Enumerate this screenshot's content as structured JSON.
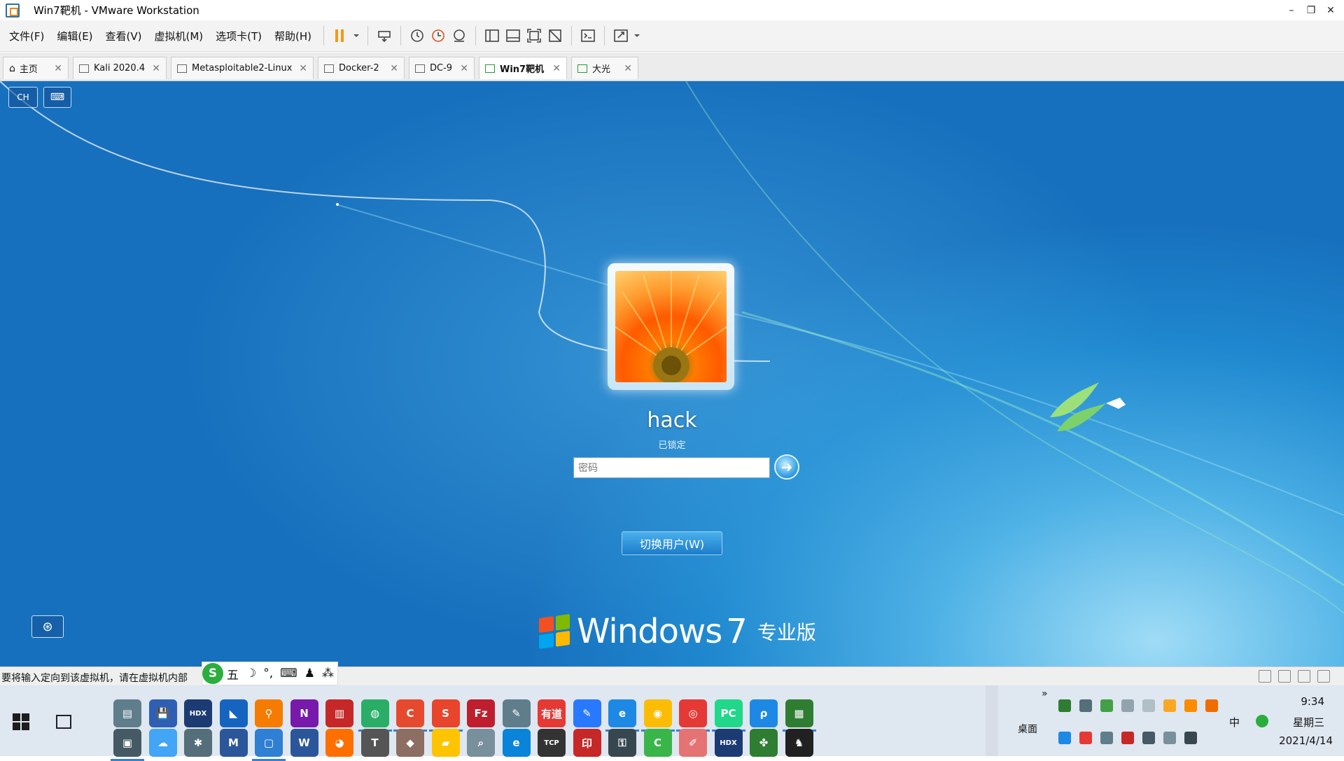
{
  "window": {
    "title": "Win7靶机 - VMware Workstation",
    "minimize": "–",
    "restore": "❐",
    "close": "✕"
  },
  "menu": [
    "文件(F)",
    "编辑(E)",
    "查看(V)",
    "虚拟机(M)",
    "选项卡(T)",
    "帮助(H)"
  ],
  "tabs": [
    {
      "label": "主页"
    },
    {
      "label": "Kali 2020.4"
    },
    {
      "label": "Metasploitable2-Linux"
    },
    {
      "label": "Docker-2"
    },
    {
      "label": "DC-9"
    },
    {
      "label": "Win7靶机"
    },
    {
      "label": "大光"
    }
  ],
  "vm": {
    "ch_label": "CH",
    "kb_label": "⌨",
    "user_name": "hack",
    "user_status": "已锁定",
    "password_placeholder": "密码",
    "go_arrow": "➜",
    "switch_user": "切换用户(W)",
    "ease_icon": "⊛",
    "brand_word": "Windows",
    "brand_version": "7",
    "brand_edition": "专业版",
    "flag_colors": [
      "#f25022",
      "#7fba00",
      "#00a4ef",
      "#ffb900"
    ]
  },
  "statusbar": {
    "message": "要将输入定向到该虚拟机，请在虚拟机内部",
    "ime": [
      "五",
      "☽",
      "°,",
      "⌨",
      "♟",
      "⁂"
    ]
  },
  "taskbar": {
    "apps": [
      {
        "name": "app-1",
        "color": "#607d8b",
        "glyph": "▤"
      },
      {
        "name": "app-2",
        "color": "#2f5fb3",
        "glyph": "💾"
      },
      {
        "name": "hdx-app",
        "color": "#1d3b73",
        "glyph": "HDX"
      },
      {
        "name": "wireshark-app",
        "color": "#1565c0",
        "glyph": "◣"
      },
      {
        "name": "search-app",
        "color": "#f57c00",
        "glyph": "⚲"
      },
      {
        "name": "onenote-app",
        "color": "#7719aa",
        "glyph": "N"
      },
      {
        "name": "library-app",
        "color": "#c62828",
        "glyph": "▥"
      },
      {
        "name": "wechat-app",
        "color": "#2aae67",
        "glyph": "◍"
      },
      {
        "name": "c-app",
        "color": "#e64a2e",
        "glyph": "C"
      },
      {
        "name": "s-app",
        "color": "#e8452c",
        "glyph": "S"
      },
      {
        "name": "filezilla-app",
        "color": "#bf1e2e",
        "glyph": "Fz"
      },
      {
        "name": "editor-app",
        "color": "#607d8b",
        "glyph": "✎"
      },
      {
        "name": "youdao-app",
        "color": "#e53935",
        "glyph": "有道"
      },
      {
        "name": "note-app",
        "color": "#2979ff",
        "glyph": "✎"
      },
      {
        "name": "edge-dev-app",
        "color": "#1e88e5",
        "glyph": "e"
      },
      {
        "name": "chrome-app",
        "color": "#fbbc05",
        "glyph": "◉"
      },
      {
        "name": "snail-app",
        "color": "#e53935",
        "glyph": "◎"
      },
      {
        "name": "pycharm-app",
        "color": "#21d789",
        "glyph": "PC"
      },
      {
        "name": "ps-app",
        "color": "#1e88e5",
        "glyph": "ρ"
      },
      {
        "name": "sheet-app",
        "color": "#2e7d32",
        "glyph": "▦"
      },
      {
        "name": "remote-app",
        "color": "#455a64",
        "glyph": "▣"
      },
      {
        "name": "baidu-app",
        "color": "#42a5f5",
        "glyph": "☁"
      },
      {
        "name": "tool-app",
        "color": "#546e7a",
        "glyph": "✱"
      },
      {
        "name": "visio-app",
        "color": "#2b579a",
        "glyph": "M"
      },
      {
        "name": "vmware-app",
        "color": "#2f7fd3",
        "glyph": "▢"
      },
      {
        "name": "word-app",
        "color": "#2b579a",
        "glyph": "W"
      },
      {
        "name": "firefox-app",
        "color": "#ff6f00",
        "glyph": "◕"
      },
      {
        "name": "typora-app",
        "color": "#555555",
        "glyph": "T"
      },
      {
        "name": "pkg-app",
        "color": "#8d6e63",
        "glyph": "◆"
      },
      {
        "name": "sticky-app",
        "color": "#ffc400",
        "glyph": "▰"
      },
      {
        "name": "magnify-app",
        "color": "#78909c",
        "glyph": "⌕"
      },
      {
        "name": "edge-app",
        "color": "#0a84d8",
        "glyph": "e"
      },
      {
        "name": "tcpip-app",
        "color": "#333333",
        "glyph": "TCP"
      },
      {
        "name": "stamp-app",
        "color": "#c62828",
        "glyph": "印"
      },
      {
        "name": "vpn-app",
        "color": "#37474f",
        "glyph": "⚿"
      },
      {
        "name": "camtasia-app",
        "color": "#3ab54a",
        "glyph": "C"
      },
      {
        "name": "paint-app",
        "color": "#e57373",
        "glyph": "✐"
      },
      {
        "name": "hdx2-app",
        "color": "#1d3b73",
        "glyph": "HDX"
      },
      {
        "name": "clover-app",
        "color": "#2e7d32",
        "glyph": "✤"
      },
      {
        "name": "qq-app",
        "color": "#212121",
        "glyph": "♞"
      }
    ],
    "desktop_label": "桌面",
    "expand": "»",
    "lang": "中",
    "time": "9:34",
    "weekday": "星期三",
    "date": "2021/4/14"
  }
}
